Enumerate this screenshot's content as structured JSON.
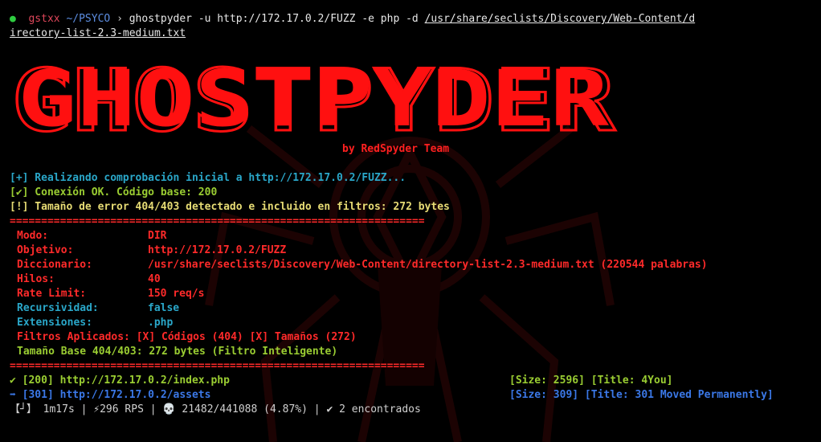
{
  "prompt": {
    "user": "gstxx",
    "cwd": "~/PSYCO",
    "sep": "›",
    "command": "ghostpyder -u http://172.17.0.2/FUZZ -e php -d ",
    "wordlist_part1": "/usr/share/seclists/Discovery/Web-Content/d",
    "wordlist_part2": "irectory-list-2.3-medium.txt"
  },
  "banner": {
    "logo_text": "GHOSTPYDER",
    "credit": "by RedSpyder Team"
  },
  "status": [
    {
      "text": "[+] Realizando comprobación inicial a http://172.17.0.2/FUZZ...",
      "color": "#2aa7c9"
    },
    {
      "text": "[✔] Conexión OK. Código base: 200",
      "color": "#9acd32"
    },
    {
      "text": "[!] Tamaño de error 404/403 detectado e incluido en filtros: 272 bytes",
      "color": "#e6db74"
    }
  ],
  "separator": "==================================================================",
  "config": [
    {
      "key": "Modo:",
      "value": "DIR",
      "kcolor": "#ff2a2a",
      "vcolor": "#ff2a2a"
    },
    {
      "key": "Objetivo:",
      "value": "http://172.17.0.2/FUZZ",
      "kcolor": "#ff2a2a",
      "vcolor": "#ff2a2a"
    },
    {
      "key": "Diccionario:",
      "value": "/usr/share/seclists/Discovery/Web-Content/directory-list-2.3-medium.txt (220544 palabras)",
      "kcolor": "#ff2a2a",
      "vcolor": "#ff2a2a"
    },
    {
      "key": "Hilos:",
      "value": "40",
      "kcolor": "#ff2a2a",
      "vcolor": "#ff2a2a"
    },
    {
      "key": "Rate Limit:",
      "value": "150 req/s",
      "kcolor": "#ff2a2a",
      "vcolor": "#ff2a2a"
    },
    {
      "key": "Recursividad:",
      "value": "false",
      "kcolor": "#2aa7c9",
      "vcolor": "#2aa7c9"
    },
    {
      "key": "Extensiones:",
      "value": ".php",
      "kcolor": "#2aa7c9",
      "vcolor": "#2aa7c9"
    }
  ],
  "filters_line": "Filtros Aplicados: [X] Códigos (404) [X] Tamaños (272)",
  "base_line": "Tamaño Base 404/403: 272 bytes (Filtro Inteligente)",
  "results": [
    {
      "prefix": "✔ [200] http://172.17.0.2/index.php",
      "info": "[Size: 2596] [Title: 4You]",
      "color": "#9acd32"
    },
    {
      "prefix": "➡ [301] http://172.17.0.2/assets",
      "info": "[Size: 309] [Title: 301 Moved Permanently]",
      "color": "#3b78e7"
    }
  ],
  "progress": {
    "spinner": "【┘】",
    "elapsed": "1m17s",
    "rps": "⚡296 RPS",
    "skull": "💀",
    "count": "21482/441088 (4.87%)",
    "found": "✔ 2 encontrados"
  }
}
